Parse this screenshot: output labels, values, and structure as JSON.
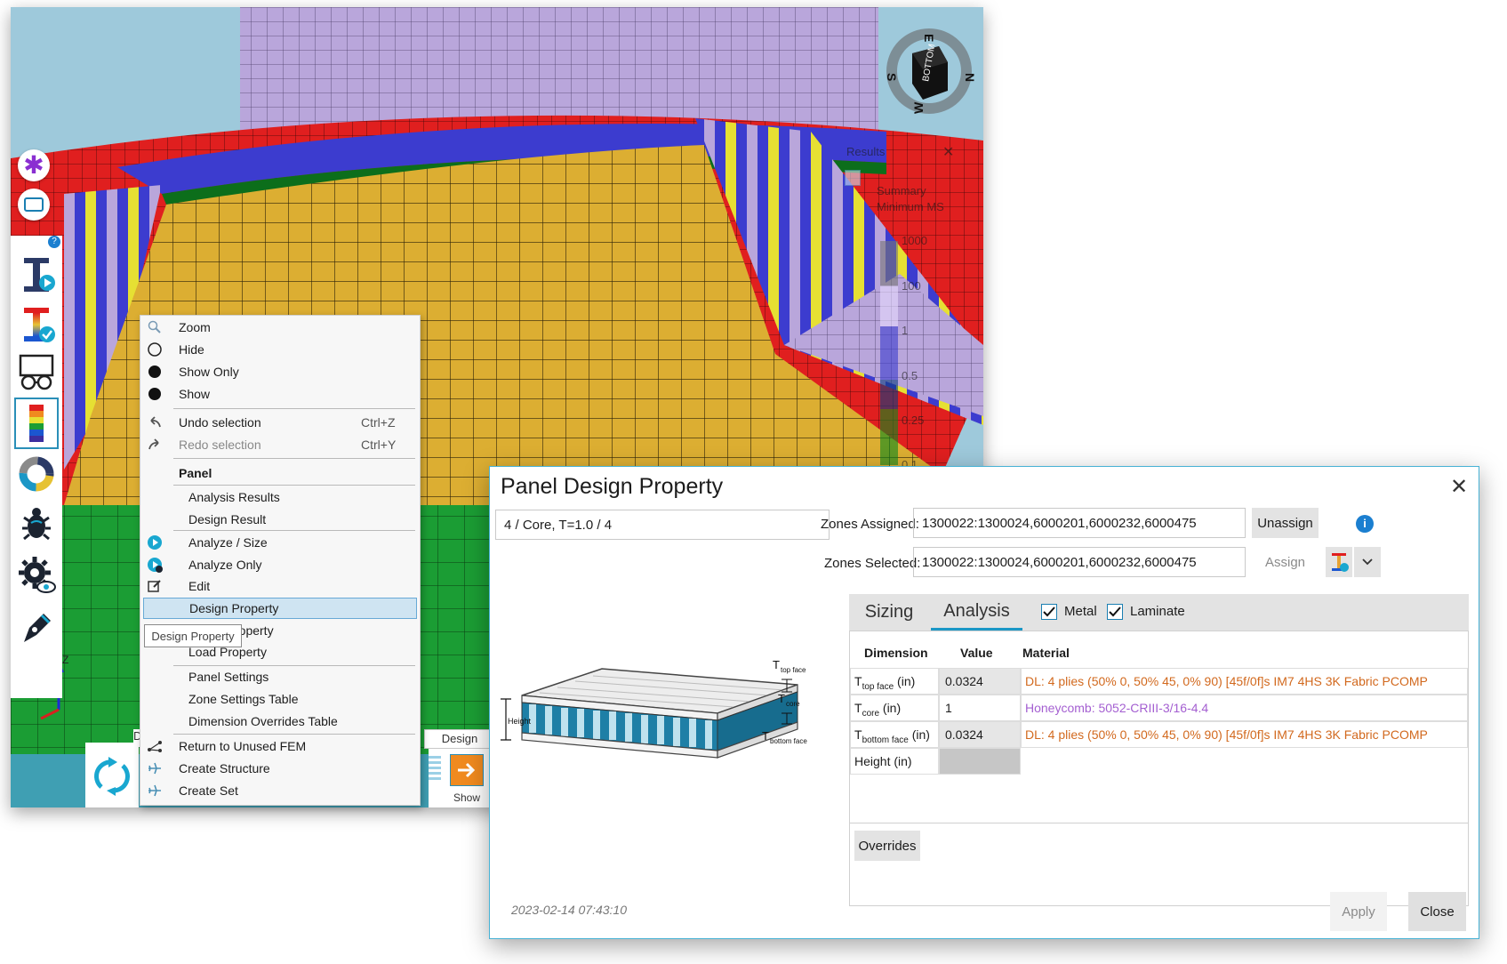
{
  "context_menu": {
    "items": [
      {
        "label": "Zoom"
      },
      {
        "label": "Hide"
      },
      {
        "label": "Show Only"
      },
      {
        "label": "Show"
      },
      {
        "label": "Undo selection",
        "shortcut": "Ctrl+Z"
      },
      {
        "label": "Redo selection",
        "shortcut": "Ctrl+Y"
      },
      {
        "label": "Panel"
      },
      {
        "label": "Analysis Results"
      },
      {
        "label": "Design Result"
      },
      {
        "label": "Analyze / Size"
      },
      {
        "label": "Analyze Only"
      },
      {
        "label": "Edit"
      },
      {
        "label": "Design Property"
      },
      {
        "label": "roperty"
      },
      {
        "label": "Load Property"
      },
      {
        "label": "Panel Settings"
      },
      {
        "label": "Zone Settings Table"
      },
      {
        "label": "Dimension Overrides Table"
      },
      {
        "label": "Return to Unused FEM"
      },
      {
        "label": "Create Structure"
      },
      {
        "label": "Create Set"
      }
    ],
    "tooltip": "Design Property"
  },
  "viewport": {
    "legend": {
      "title": "Results",
      "subtitle1": "Summary",
      "subtitle2": "Minimum MS",
      "values": [
        "1000",
        "100",
        "1",
        "0.5",
        "0.25",
        "0.1"
      ]
    },
    "viewcube_face": "BOTTOM",
    "compass": [
      "E",
      "N",
      "S",
      "W"
    ],
    "toolbar_labels": {
      "design": "Design",
      "show": "Show",
      "partial": "D"
    }
  },
  "dialog": {
    "title": "Panel Design Property",
    "property_name": "4 / Core, T=1.0 / 4",
    "zones_assigned_label": "Zones Assigned:",
    "zones_assigned_value": "1300022:1300024,6000201,6000232,6000475",
    "zones_selected_label": "Zones Selected:",
    "zones_selected_value": "1300022:1300024,6000201,6000232,6000475",
    "unassign_label": "Unassign",
    "assign_label": "Assign",
    "tabs": [
      {
        "label": "Sizing"
      },
      {
        "label": "Analysis"
      }
    ],
    "metal_label": "Metal",
    "laminate_label": "Laminate",
    "metal_checked": true,
    "laminate_checked": true,
    "columns": {
      "dimension": "Dimension",
      "value": "Value",
      "material": "Material"
    },
    "rows": [
      {
        "dim_main": "T",
        "dim_sub": "top face",
        "dim_unit": " (in)",
        "value": "0.0324",
        "material": "DL: 4 plies (50% 0, 50% 45, 0% 90) [45f/0f]s IM7 4HS 3K Fabric PCOMP"
      },
      {
        "dim_main": "T",
        "dim_sub": "core",
        "dim_unit": " (in)",
        "value": "1",
        "material": "Honeycomb: 5052-CRIII-3/16-4.4"
      },
      {
        "dim_main": "T",
        "dim_sub": "bottom face",
        "dim_unit": " (in)",
        "value": "0.0324",
        "material": "DL: 4 plies (50% 0, 50% 45, 0% 90) [45f/0f]s IM7 4HS 3K Fabric PCOMP"
      },
      {
        "dim_main": "Height",
        "dim_sub": "",
        "dim_unit": " (in)",
        "value": "",
        "material": ""
      }
    ],
    "overrides_label": "Overrides",
    "diagram_labels": {
      "top": "top face",
      "core": "core",
      "bottom": "bottom face",
      "height": "Height",
      "t": "T"
    },
    "timestamp": "2023-02-14 07:43:10",
    "apply_label": "Apply",
    "close_label": "Close"
  },
  "colors": {
    "accent": "#1b97c6",
    "laminate_material": "#d2691e",
    "honeycomb_material": "#a45fd1",
    "mesh_yellow": "#dcae32",
    "mesh_red": "#e01f1f",
    "mesh_blue": "#3c3ccf",
    "mesh_green": "#0c8a1d",
    "mesh_lavender": "#b9a6db"
  }
}
